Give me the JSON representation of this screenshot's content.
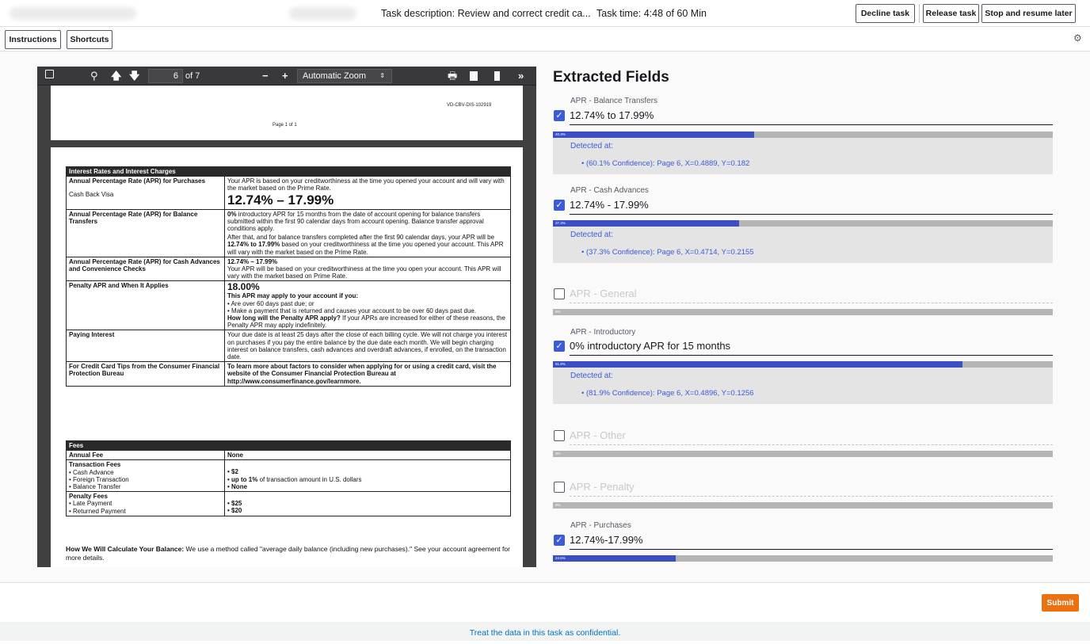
{
  "header": {
    "task_description": "Task description: Review and correct credit ca...",
    "task_time": "Task time: 4:48 of 60 Min",
    "decline": "Decline task",
    "release": "Release task",
    "stop": "Stop and resume later"
  },
  "subbar": {
    "instructions": "Instructions",
    "shortcuts": "Shortcuts"
  },
  "viewer": {
    "page_number": "6",
    "page_count": "of 7",
    "zoom": "Automatic Zoom",
    "page1_id": "VD-CBV-DIS-102919",
    "page1_footer": "Page 1 of 1",
    "interest": {
      "header": "Interest Rates and Interest Charges",
      "purchases_label": "Annual Percentage Rate (APR) for Purchases",
      "purchases_sub": "Cash Back Visa",
      "purchases_text": "Your APR is based on your creditworthiness at the time you opened your account and will vary with the market based on the Prime Rate.",
      "purchases_rate": "12.74% – 17.99%",
      "bt_label": "Annual Percentage Rate (APR) for Balance Transfers",
      "bt_intro_bold": "0%",
      "bt_intro": " introductory APR for 15 months from the date of account opening for balance transfers submitted within the first 90 calendar days from account opening. Balance transfer approval conditions apply.",
      "bt_after": "After that, and for balance transfers completed after the first 90 calendar days, your APR will be ",
      "bt_after_bold": "12.74% to 17.99%",
      "bt_after_end": " based on your creditworthiness at the time you opened your account. This APR will vary with the market based on the Prime Rate.",
      "ca_label": "Annual Percentage Rate (APR) for Cash Advances and Convenience Checks",
      "ca_rate": "12.74% – 17.99%",
      "ca_text": "Your APR will be based on your creditworthiness at the time you open your account. This APR will vary with the market based on Prime Rate.",
      "pen_label": "Penalty APR and When It Applies",
      "pen_rate": "18.00%",
      "pen_may": "This APR may apply to your account if you:",
      "pen_b1": "• Are over 60 days past due; or",
      "pen_b2": "• Make a payment that is returned and causes your account to be over 60 days past due.",
      "pen_how_bold": "How long will the Penalty APR apply?",
      "pen_how": " If your APRs are increased for either of these reasons, the Penalty APR may apply indefinitely.",
      "pi_label": "Paying Interest",
      "pi_text": "Your due date is at least 25 days after the close of each billing cycle. We will not charge you interest on purchases if you pay the entire balance by the due date each month. We will begin charging interest on balance transfers, cash advances and overdraft advances, if enrolled, on the transaction date.",
      "tips_label": "For Credit Card Tips from the Consumer Financial Protection Bureau",
      "tips_text": "To learn more about factors to consider when applying for or using a credit card, visit the website of the Consumer Financial Protection Bureau at http://www.consumerfinance.gov/learnmore."
    },
    "fees": {
      "header": "Fees",
      "annual_label": "Annual Fee",
      "annual_value": "None",
      "tx_label": "Transaction Fees",
      "tx_items": [
        "• Cash Advance",
        "• Foreign Transaction",
        "• Balance Transfer"
      ],
      "tx_v1": "•   $2",
      "tx_v2_bold": "•   up to 1%",
      "tx_v2": " of transaction amount in U.S. dollars",
      "tx_v3": "•   None",
      "pen_label": "Penalty Fees",
      "pen_items": [
        "• Late Payment",
        "• Returned Payment"
      ],
      "pen_v1": "•   $25",
      "pen_v2": "•   $20"
    },
    "balance_bold": "How We Will Calculate Your Balance:",
    "balance_text": " We use a method called \"average daily balance (including new purchases).\" See your account agreement for more details."
  },
  "fields": {
    "title": "Extracted Fields",
    "detected_label": "Detected at:",
    "items": [
      {
        "label": "APR - Balance Transfers",
        "value": "12.74% to 17.99%",
        "checked": true,
        "confidence": 0.403,
        "pct": "40.3%",
        "detail": "• (60.1% Confidence): Page 6, X=0.4889, Y=0.182"
      },
      {
        "label": "APR - Cash Advances",
        "value": "12.74% - 17.99%",
        "checked": true,
        "confidence": 0.373,
        "pct": "37.3%",
        "detail": "• (37.3% Confidence): Page 6, X=0.4714, Y=0.2155"
      },
      {
        "label": "",
        "value": "APR - General",
        "checked": false,
        "confidence": 0,
        "pct": "0%"
      },
      {
        "label": "APR - Introductory",
        "value": "0% introductory APR for 15 months",
        "checked": true,
        "confidence": 0.819,
        "pct": "81.9%",
        "detail": "• (81.9% Confidence): Page 6, X=0.4896, Y=0.1256"
      },
      {
        "label": "",
        "value": "APR - Other",
        "checked": false,
        "confidence": 0,
        "pct": "0%"
      },
      {
        "label": "",
        "value": "APR - Penalty",
        "checked": false,
        "confidence": 0,
        "pct": "0%"
      },
      {
        "label": "APR - Purchases",
        "value": "12.74%-17.99%",
        "checked": true,
        "confidence": 0.246,
        "pct": "24.6%"
      }
    ]
  },
  "footer": {
    "submit": "Submit",
    "confidential": "Treat the data in this task as confidential."
  },
  "colors": {
    "accent": "#3b5bdb",
    "submit": "#ec7211",
    "link": "#0073bb"
  }
}
